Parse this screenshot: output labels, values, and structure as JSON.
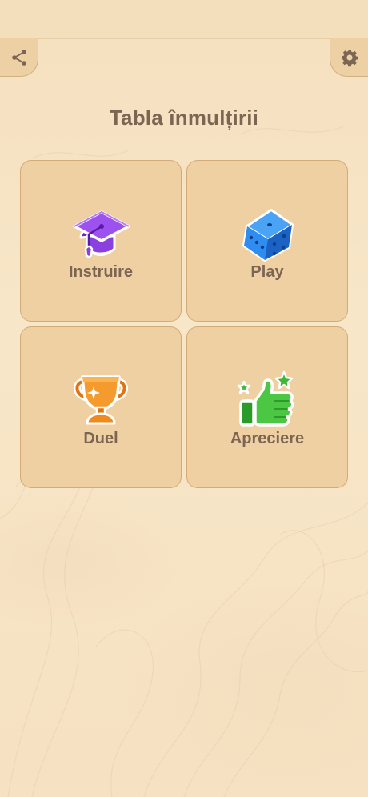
{
  "header": {
    "share_icon": "share-icon",
    "settings_icon": "gear-icon"
  },
  "title": "Tabla înmulțirii",
  "menu": [
    {
      "label": "Instruire",
      "icon": "graduation-cap-icon",
      "color": "#8b3fe0"
    },
    {
      "label": "Play",
      "icon": "dice-icon",
      "color": "#2f8cf0"
    },
    {
      "label": "Duel",
      "icon": "trophy-icon",
      "color": "#f08a1c"
    },
    {
      "label": "Apreciere",
      "icon": "thumbs-up-icon",
      "color": "#3fb83a"
    }
  ],
  "colors": {
    "background": "#f6e2c2",
    "tile": "#eed0a2",
    "text": "#7d6553"
  }
}
